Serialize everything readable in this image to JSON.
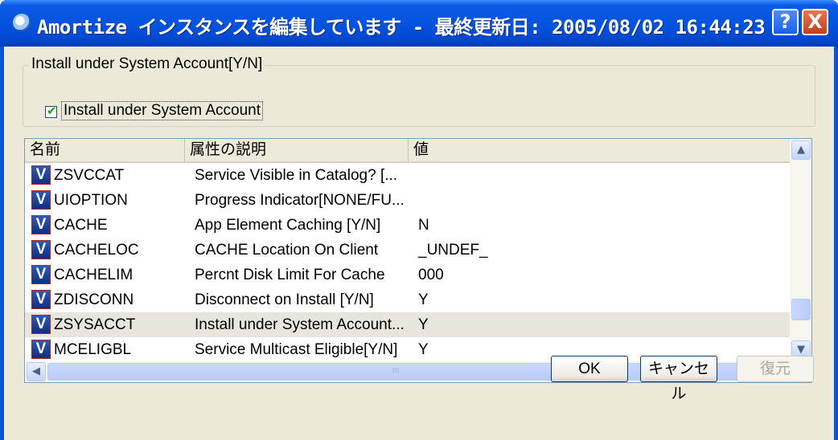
{
  "window": {
    "title": "Amortize インスタンスを編集しています - 最終更新日: 2005/08/02 16:44:23",
    "help_label": "?",
    "close_label": "X"
  },
  "group": {
    "legend": "Install under System Account[Y/N]",
    "checkbox_label": "Install under System Account",
    "checked": true
  },
  "list": {
    "headers": [
      "名前",
      "属性の説明",
      "値"
    ],
    "rows": [
      {
        "icon": "V",
        "name": "ZSVCCAT",
        "desc": "Service Visible in Catalog? [...",
        "value": "",
        "selected": false
      },
      {
        "icon": "V",
        "name": "UIOPTION",
        "desc": "Progress Indicator[NONE/FU...",
        "value": "",
        "selected": false
      },
      {
        "icon": "V",
        "name": "CACHE",
        "desc": "App Element Caching [Y/N]",
        "value": "N",
        "selected": false
      },
      {
        "icon": "V",
        "name": "CACHELOC",
        "desc": "CACHE Location On Client",
        "value": "_UNDEF_",
        "selected": false
      },
      {
        "icon": "V",
        "name": "CACHELIM",
        "desc": "Percnt Disk Limit For Cache",
        "value": "000",
        "selected": false
      },
      {
        "icon": "V",
        "name": "ZDISCONN",
        "desc": "Disconnect on Install [Y/N]",
        "value": "Y",
        "selected": false
      },
      {
        "icon": "V",
        "name": "ZSYSACCT",
        "desc": "Install under System Account...",
        "value": "Y",
        "selected": true
      },
      {
        "icon": "V",
        "name": "MCELIGBL",
        "desc": "Service Multicast Eligible[Y/N]",
        "value": "Y",
        "selected": false
      }
    ],
    "scroll_up": "▲",
    "scroll_down": "▼",
    "scroll_left": "◀",
    "scroll_right": "▶",
    "hthumb_grip": "III"
  },
  "buttons": {
    "ok": "OK",
    "cancel": "キャンセル",
    "restore": "復元"
  }
}
